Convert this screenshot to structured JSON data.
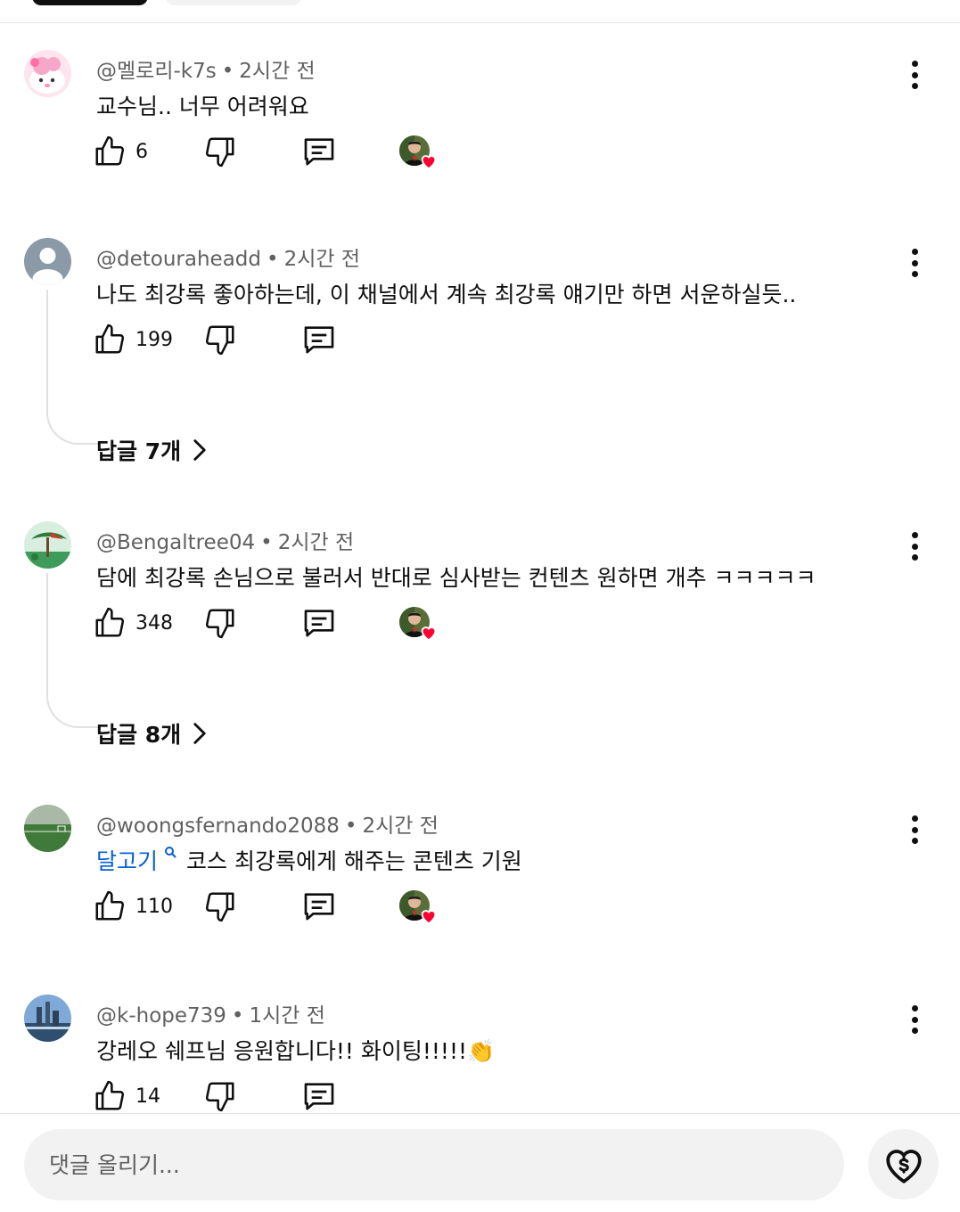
{
  "comments": [
    {
      "author": "@멜로리-k7s",
      "time": "2시간 전",
      "text": "교수님.. 너무 어려워요",
      "likes": "6",
      "creator_hearted": true
    },
    {
      "author": "@detouraheadd",
      "time": "2시간 전",
      "text": "나도 최강록 좋아하는데, 이 채널에서 계속 최강록 얘기만 하면 서운하실듯..",
      "likes": "199",
      "creator_hearted": false,
      "replies_label": "답글 7개"
    },
    {
      "author": "@Bengaltree04",
      "time": "2시간 전",
      "text": "담에 최강록 손님으로 불러서 반대로 심사받는 컨텐츠 원하면 개추 ㅋㅋㅋㅋㅋ",
      "likes": "348",
      "creator_hearted": true,
      "replies_label": "답글 8개"
    },
    {
      "author": "@woongsfernando2088",
      "time": "2시간 전",
      "link_text": "달고기",
      "text": "코스 최강록에게 해주는 콘텐츠 기원",
      "likes": "110",
      "creator_hearted": true
    },
    {
      "author": "@k-hope739",
      "time": "1시간 전",
      "text": "강레오 쉐프님 응원합니다!! 화이팅!!!!!👏",
      "likes": "14",
      "creator_hearted": false
    }
  ],
  "composer": {
    "placeholder": "댓글 올리기..."
  },
  "colors": {
    "link": "#065fd4",
    "heart": "#ff0033",
    "secondary_text": "#606060",
    "input_bg": "#f2f2f2"
  },
  "icons": [
    "thumbs-up-icon",
    "thumbs-down-icon",
    "reply-icon",
    "more-vert-icon",
    "chevron-right-icon",
    "search-icon",
    "super-thanks-icon",
    "heart-icon"
  ]
}
